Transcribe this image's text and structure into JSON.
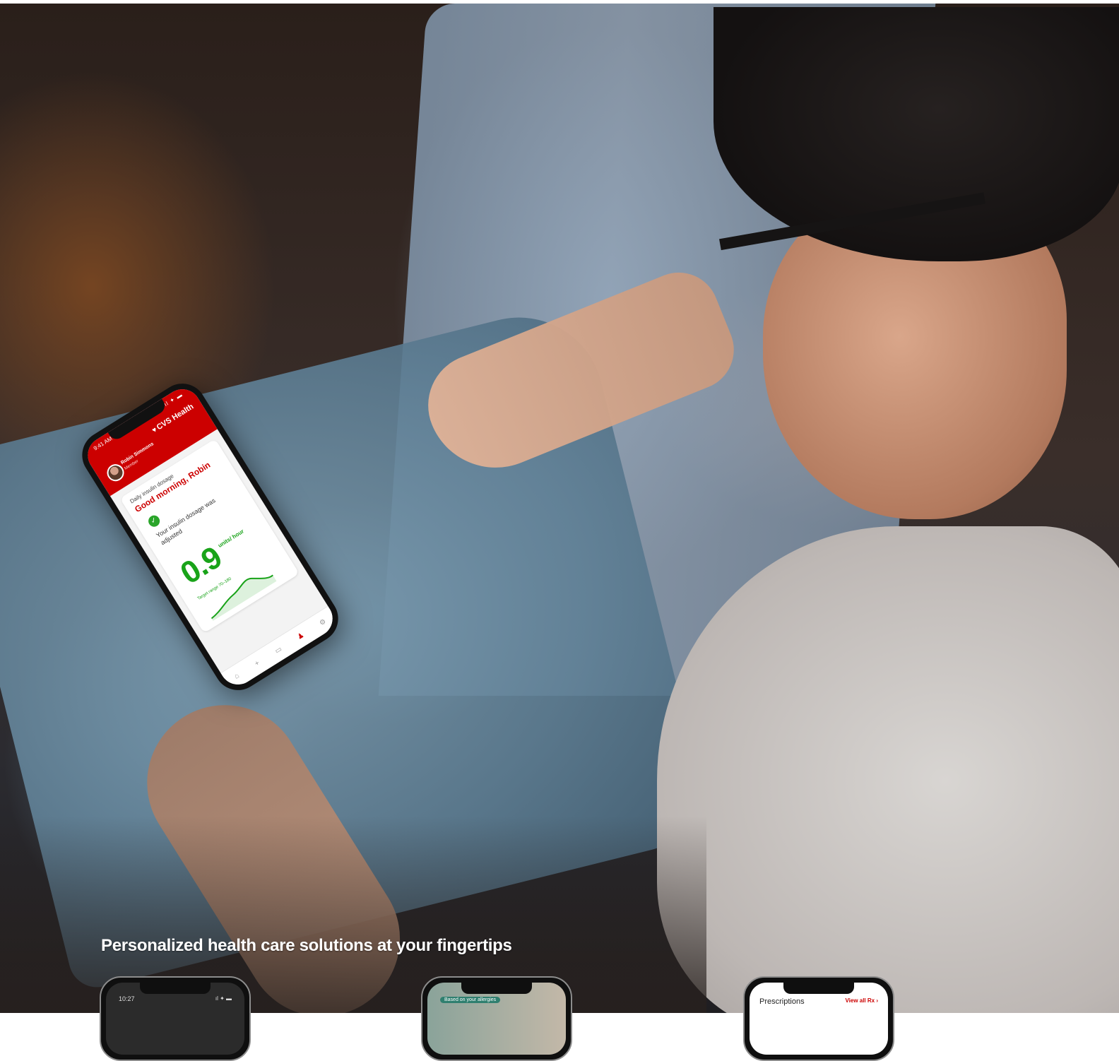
{
  "tagline": "Personalized health care solutions at your fingertips",
  "colors": {
    "brand_red": "#cc0000",
    "dose_green": "#19a319",
    "tagline_text": "#ffffff"
  },
  "hero_phone": {
    "status_time": "9:41 AM",
    "status_icons": "•ıl ✦ ▬",
    "brand": "CVS Health",
    "brand_icon": "heart-icon",
    "user_name": "Robin Simmons",
    "user_sub": "Member",
    "card": {
      "kicker": "Daily insulin dosage",
      "title": "Good morning, Robin",
      "message": "Your insulin dosage was adjusted",
      "dose_value": "0.9",
      "dose_unit": "units/ hour",
      "range_label": "Target range 70–180"
    },
    "tabs": [
      {
        "icon": "home-icon",
        "glyph": "⌂"
      },
      {
        "icon": "plus-icon",
        "glyph": "+"
      },
      {
        "icon": "calendar-icon",
        "glyph": "▭"
      },
      {
        "icon": "person-icon",
        "glyph": "♟"
      },
      {
        "icon": "settings-icon",
        "glyph": "⚙"
      }
    ]
  },
  "preview_phones": [
    {
      "time": "10:27",
      "icons": "ıl ✦ ▬"
    },
    {
      "badge": "Based on your allergies"
    },
    {
      "title": "Prescriptions",
      "link": "View all Rx  ›"
    }
  ]
}
